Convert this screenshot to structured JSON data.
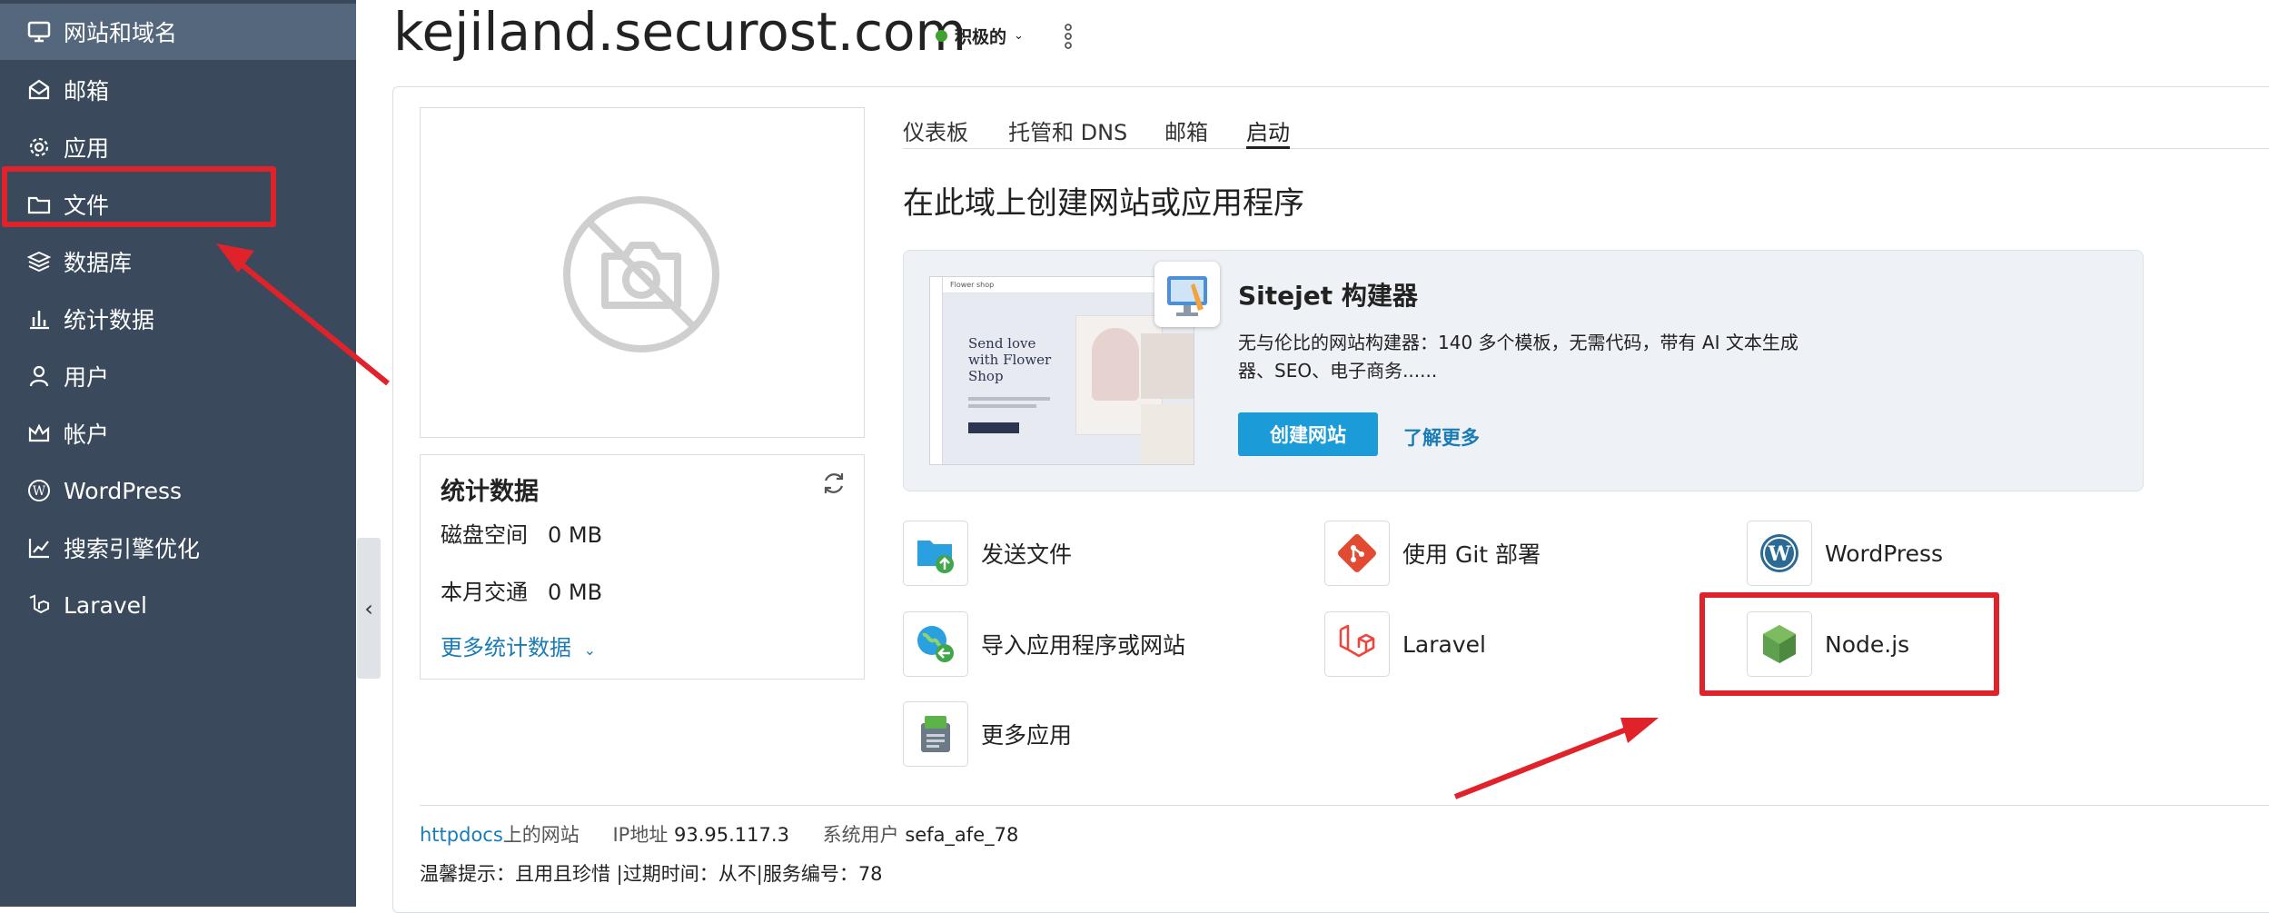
{
  "sidebar": {
    "items": [
      {
        "label": "网站和域名",
        "icon": "monitor-icon"
      },
      {
        "label": "邮箱",
        "icon": "mail-icon"
      },
      {
        "label": "应用",
        "icon": "gear-icon"
      },
      {
        "label": "文件",
        "icon": "folder-icon"
      },
      {
        "label": "数据库",
        "icon": "database-layers-icon"
      },
      {
        "label": "统计数据",
        "icon": "bar-chart-icon"
      },
      {
        "label": "用户",
        "icon": "user-icon"
      },
      {
        "label": "帐户",
        "icon": "crown-icon"
      },
      {
        "label": "WordPress",
        "icon": "wordpress-icon"
      },
      {
        "label": "搜索引擎优化",
        "icon": "seo-chart-icon"
      },
      {
        "label": "Laravel",
        "icon": "laravel-icon"
      }
    ]
  },
  "header": {
    "domain": "kejiland.securost.com",
    "status": "积极的",
    "status_color": "#3fa12f"
  },
  "stats": {
    "title": "统计数据",
    "disk_label": "磁盘空间",
    "disk_value": "0 MB",
    "traffic_label": "本月交通",
    "traffic_value": "0 MB",
    "more_link": "更多统计数据"
  },
  "tabs": [
    "仪表板",
    "托管和 DNS",
    "邮箱",
    "启动"
  ],
  "active_tab": "启动",
  "section_heading": "在此域上创建网站或应用程序",
  "sitejet": {
    "title": "Sitejet 构建器",
    "description": "无与伦比的网站构建器：140 多个模板，无需代码，带有 AI 文本生成器、SEO、电子商务......",
    "create_button": "创建网站",
    "learn_more": "了解更多",
    "preview_heading": "Send love with Flower Shop",
    "preview_brand": "Flower shop"
  },
  "apps": [
    {
      "label": "发送文件",
      "icon": "upload-folder-icon"
    },
    {
      "label": "使用 Git 部署",
      "icon": "git-icon"
    },
    {
      "label": "WordPress",
      "icon": "wordpress-icon"
    },
    {
      "label": "导入应用程序或网站",
      "icon": "import-globe-icon"
    },
    {
      "label": "Laravel",
      "icon": "laravel-icon"
    },
    {
      "label": "Node.js",
      "icon": "nodejs-icon"
    },
    {
      "label": "更多应用",
      "icon": "app-box-icon"
    }
  ],
  "footer": {
    "docroot_link": "httpdocs",
    "docroot_suffix": "上的网站",
    "ip_label": "IP地址",
    "ip_value": "93.95.117.3",
    "sysuser_label": "系统用户",
    "sysuser_value": "sefa_afe_78",
    "notice": "温馨提示：且用且珍惜 |过期时间：从不|服务编号：78"
  },
  "colors": {
    "sidebar_bg": "#3a4a5c",
    "accent": "#1b9bd7",
    "link": "#1a7cb6",
    "annotation_red": "#e0232b"
  }
}
